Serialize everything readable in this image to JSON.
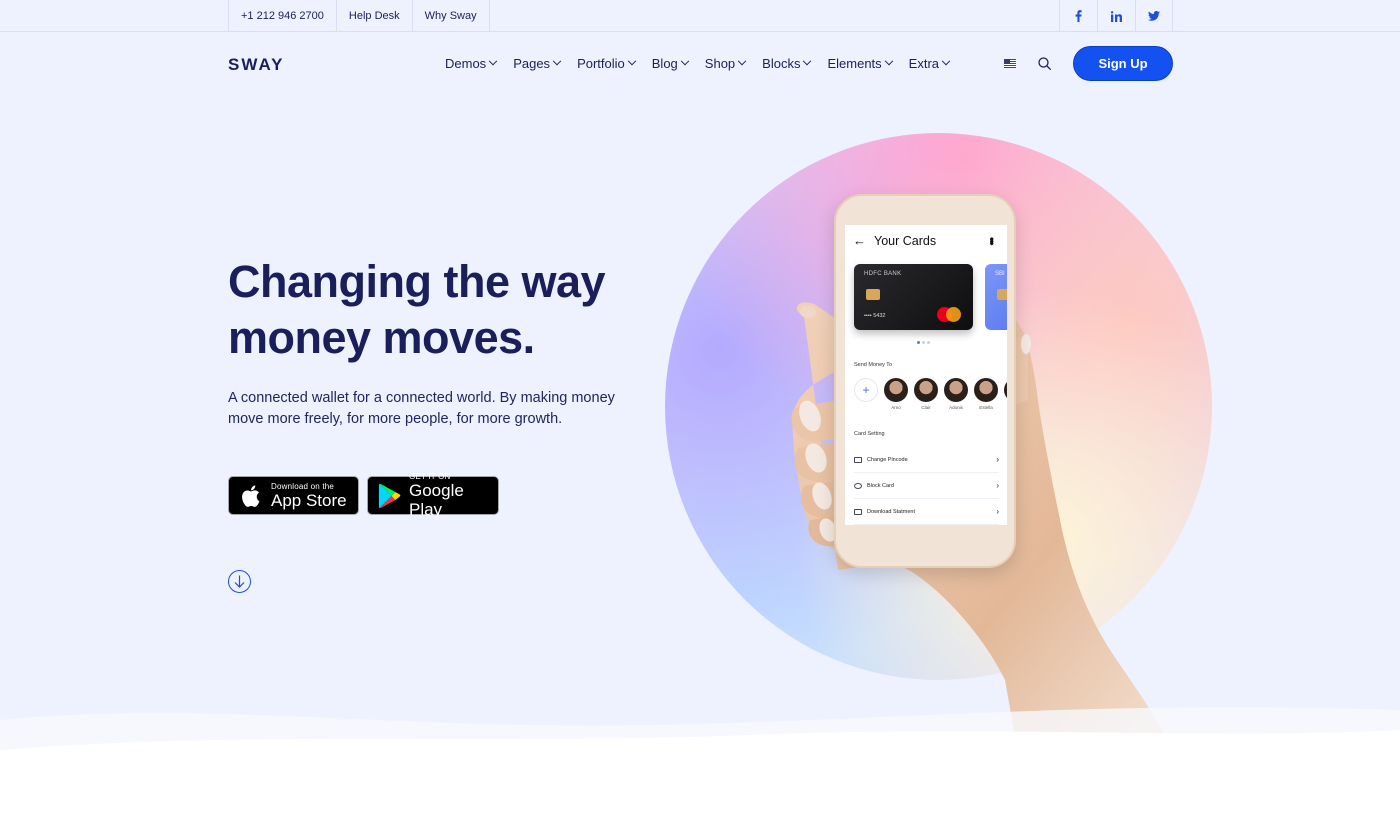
{
  "topbar": {
    "links": [
      "+1 212 946 2700",
      "Help Desk",
      "Why Sway"
    ],
    "social": [
      {
        "icon": "facebook-icon",
        "glyph": "f"
      },
      {
        "icon": "linkedin-icon",
        "glyph": "in"
      },
      {
        "icon": "twitter-icon",
        "glyph": "🐦"
      }
    ]
  },
  "header": {
    "logo": "SWAY",
    "nav": [
      "Demos",
      "Pages",
      "Portfolio",
      "Blog",
      "Shop",
      "Blocks",
      "Elements",
      "Extra"
    ],
    "signup_label": "Sign Up",
    "accent": "#1352f1"
  },
  "hero": {
    "title": "Changing the way money moves.",
    "subtitle": "A connected wallet for a connected world. By making money move more freely, for more people, for more growth.",
    "app_store": {
      "small": "Download on the",
      "big": "App Store"
    },
    "google_play": {
      "small": "GET IT ON",
      "big": "Google Play"
    }
  },
  "phone": {
    "title": "Your Cards",
    "card_bank": "HDFC BANK",
    "card_number": "•••• 5432",
    "card2_bank": "SBI",
    "send_money_label": "Send Money To",
    "contacts": [
      "Arno",
      "Clair",
      "Adonis",
      "Estella",
      "Er"
    ],
    "card_setting_label": "Card Setting",
    "settings": [
      "Change Pincode",
      "Block  Card",
      "Download Statment"
    ]
  }
}
